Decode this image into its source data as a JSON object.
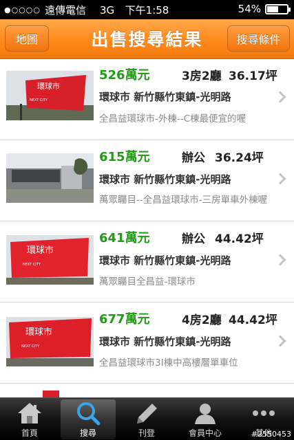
{
  "status": {
    "carrier": "遠傳電信",
    "network": "3G",
    "time": "下午1:58",
    "battery": "54%",
    "battery_level": 0.54,
    "signal_dots": "●○○○○"
  },
  "nav": {
    "title": "出售搜尋結果",
    "left_button": "地圖",
    "right_button": "搜尋條件"
  },
  "listings": [
    {
      "price": "526萬元",
      "rooms": "3房2廳",
      "area": "36.17坪",
      "address": "環球市 新竹縣竹東鎮-光明路",
      "description": "全昌益環球市-外棟--C棟最便宜的喔"
    },
    {
      "price": "615萬元",
      "rooms": "辦公",
      "area": "36.24坪",
      "address": "環球市 新竹縣竹東鎮-光明路",
      "description": "萬眾矚目--全昌益環球市-三房單車外棟喔"
    },
    {
      "price": "641萬元",
      "rooms": "辦公",
      "area": "44.42坪",
      "address": "環球市 新竹縣竹東鎮-光明路",
      "description": "萬眾矚目全昌益-環球市"
    },
    {
      "price": "677萬元",
      "rooms": "4房2廳",
      "area": "44.42坪",
      "address": "環球市 新竹縣竹東鎮-光明路",
      "description": "全昌益環球市3I棟中高樓層單車位"
    }
  ],
  "thumb_sign": {
    "title": "環球市",
    "sub": "NEXT CITY"
  },
  "tabs": [
    {
      "label": "首頁",
      "icon": "home-icon"
    },
    {
      "label": "搜尋",
      "icon": "search-icon"
    },
    {
      "label": "刊登",
      "icon": "pencil-icon"
    },
    {
      "label": "會員中心",
      "icon": "member-icon"
    },
    {
      "label": "其他",
      "icon": "more-icon"
    }
  ],
  "watermark": "#2550453",
  "colors": {
    "accent": "#ff8a1c",
    "price": "#219a16"
  }
}
